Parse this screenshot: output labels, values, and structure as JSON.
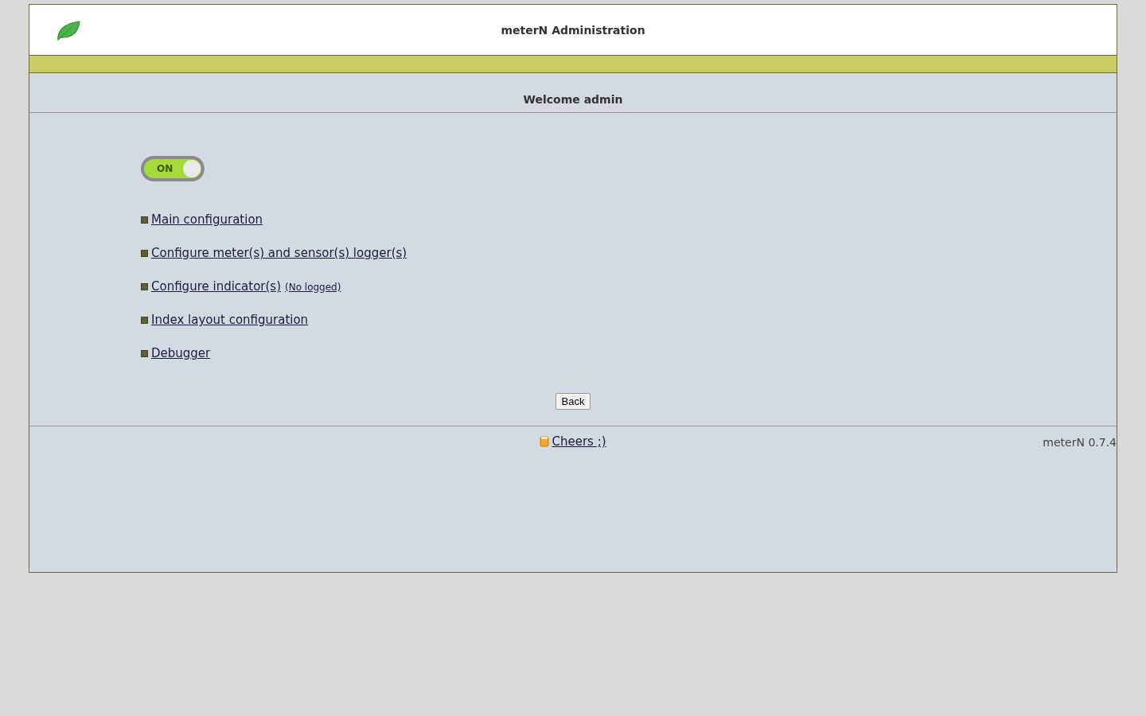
{
  "header": {
    "title": "meterN Administration"
  },
  "welcome": "Welcome admin",
  "toggle": {
    "label": "ON",
    "on": true
  },
  "links": [
    {
      "label": "Main configuration"
    },
    {
      "label": "Configure meter(s) and sensor(s) logger(s)"
    },
    {
      "label": "Configure indicator(s)",
      "note": "(No logged)"
    },
    {
      "label": "Index layout configuration"
    },
    {
      "label": "Debugger"
    }
  ],
  "back_button": "Back",
  "footer": {
    "link": "Cheers ;)",
    "version": "meterN 0.7.4"
  }
}
